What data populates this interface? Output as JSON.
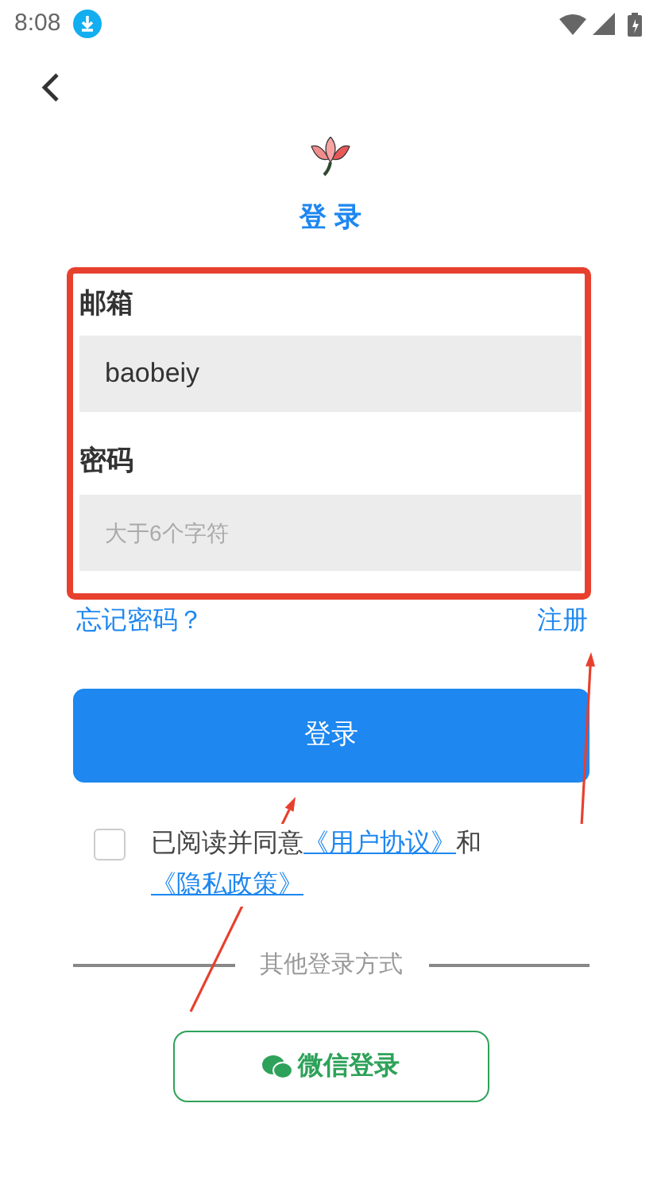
{
  "status_bar": {
    "time": "8:08"
  },
  "header": {
    "title": "登 录"
  },
  "form": {
    "highlighted": true,
    "fields": [
      {
        "label": "邮箱",
        "value": "baobeiy",
        "kind": "text"
      },
      {
        "label": "密码",
        "placeholder": "大于6个字符",
        "kind": "password"
      }
    ]
  },
  "links": {
    "forgot": "忘记密码？",
    "register": "注册"
  },
  "login_button": "登录",
  "agreement": {
    "checked": false,
    "parts": [
      {
        "kind": "text",
        "text": "已阅读并同意"
      },
      {
        "kind": "link",
        "text": "《用户协议》"
      },
      {
        "kind": "text",
        "text": "和"
      },
      {
        "kind": "link",
        "text": "《隐私政策》"
      }
    ]
  },
  "other_login": {
    "label": "其他登录方式",
    "wechat_button": "微信登录"
  },
  "annotations": [
    {
      "kind": "arrow"
    },
    {
      "kind": "arrow"
    }
  ]
}
